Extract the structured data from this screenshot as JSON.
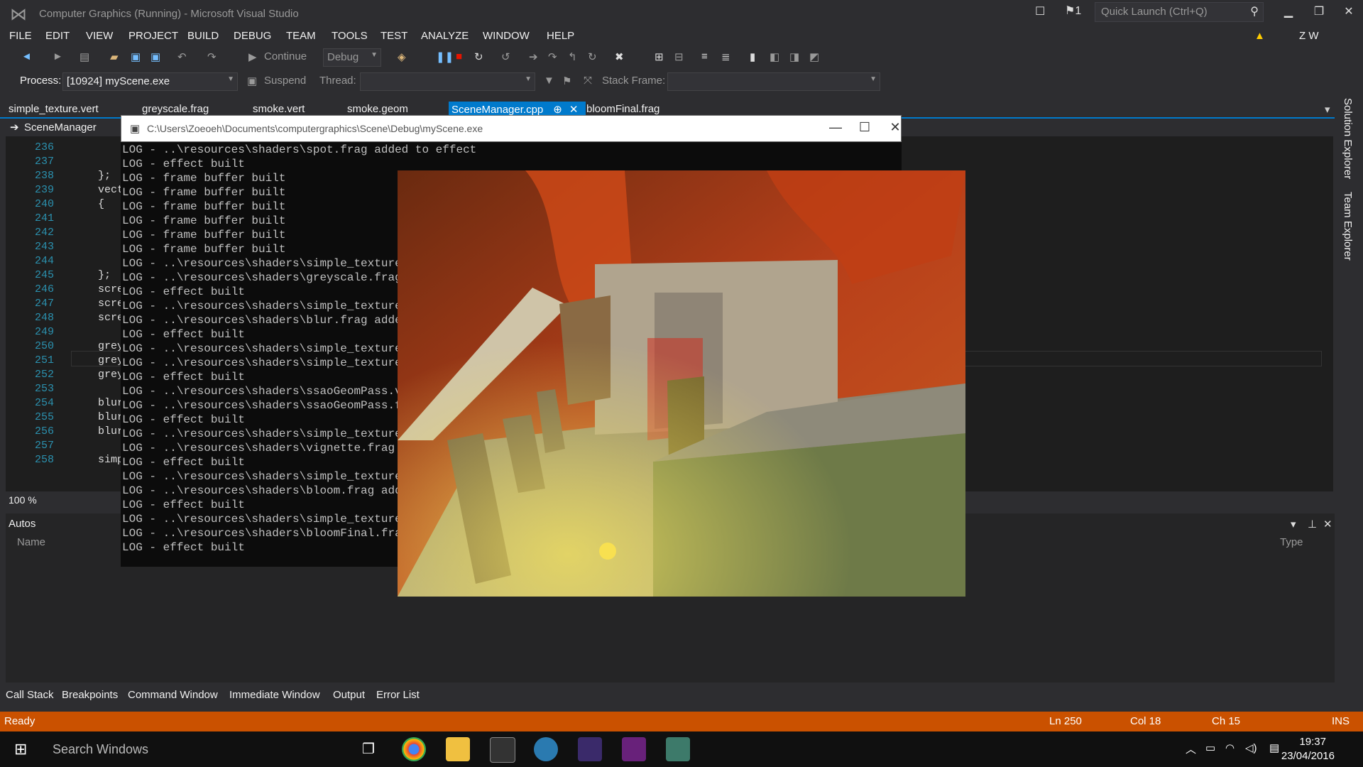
{
  "window": {
    "title": "Computer Graphics (Running) - Microsoft Visual Studio",
    "user": "Z W",
    "notifications": "1",
    "quick_launch_placeholder": "Quick Launch (Ctrl+Q)"
  },
  "menu": [
    "FILE",
    "EDIT",
    "VIEW",
    "PROJECT",
    "BUILD",
    "DEBUG",
    "TEAM",
    "TOOLS",
    "TEST",
    "ANALYZE",
    "WINDOW",
    "HELP"
  ],
  "toolbar": {
    "continue_label": "Continue",
    "config": "Debug",
    "process_label": "Process:",
    "process_value": "[10924] myScene.exe",
    "suspend_label": "Suspend",
    "thread_label": "Thread:",
    "stack_frame_label": "Stack Frame:"
  },
  "tabs": [
    "simple_texture.vert",
    "greyscale.frag",
    "smoke.vert",
    "smoke.geom",
    "SceneManager.cpp",
    "bloomFinal.frag"
  ],
  "active_tab_index": 4,
  "nav": {
    "scope": "SceneManager"
  },
  "editor": {
    "line_numbers": [
      "236",
      "237",
      "238",
      "239",
      "240",
      "241",
      "242",
      "243",
      "244",
      "245",
      "246",
      "247",
      "248",
      "249",
      "250",
      "251",
      "252",
      "253",
      "254",
      "255",
      "256",
      "257",
      "258"
    ],
    "code_lines": [
      "",
      "",
      "};",
      "vect",
      "{",
      "",
      "",
      "",
      "",
      "};",
      "scre",
      "scre",
      "scre",
      "",
      "grey",
      "grey",
      "grey",
      "",
      "blur",
      "blur",
      "blur",
      "",
      "simp"
    ],
    "zoom": "100 %"
  },
  "autos": {
    "title": "Autos",
    "col_name": "Name",
    "col_type": "Type"
  },
  "bottom_tabs": [
    "Call Stack",
    "Breakpoints",
    "Command Window",
    "Immediate Window",
    "Output",
    "Error List"
  ],
  "status": {
    "state": "Ready",
    "ln": "Ln 250",
    "col": "Col 18",
    "ch": "Ch 15",
    "mode": "INS"
  },
  "side_tabs": [
    "Solution Explorer",
    "Team Explorer"
  ],
  "console": {
    "title": "C:\\Users\\Zoeoeh\\Documents\\computergraphics\\Scene\\Debug\\myScene.exe",
    "lines": [
      "LOG - ..\\resources\\shaders\\spot.frag added to effect",
      "LOG - effect built",
      "LOG - frame buffer built",
      "LOG - frame buffer built",
      "LOG - frame buffer built",
      "LOG - frame buffer built",
      "LOG - frame buffer built",
      "LOG - frame buffer built",
      "LOG - ..\\resources\\shaders\\simple_texture.ve",
      "LOG - ..\\resources\\shaders\\greyscale.frag ad",
      "LOG - effect built",
      "LOG - ..\\resources\\shaders\\simple_texture.ve",
      "LOG - ..\\resources\\shaders\\blur.frag added t",
      "LOG - effect built",
      "LOG - ..\\resources\\shaders\\simple_texture.ve",
      "LOG - ..\\resources\\shaders\\simple_texture.fr",
      "LOG - effect built",
      "LOG - ..\\resources\\shaders\\ssaoGeomPass.vert",
      "LOG - ..\\resources\\shaders\\ssaoGeomPass.frag",
      "LOG - effect built",
      "LOG - ..\\resources\\shaders\\simple_texture.ve",
      "LOG - ..\\resources\\shaders\\vignette.frag add",
      "LOG - effect built",
      "LOG - ..\\resources\\shaders\\simple_texture.ve",
      "LOG - ..\\resources\\shaders\\bloom.frag added",
      "LOG - effect built",
      "LOG - ..\\resources\\shaders\\simple_texture.ve",
      "LOG - ..\\resources\\shaders\\bloomFinal.frag a",
      "LOG - effect built"
    ]
  },
  "taskbar": {
    "search_placeholder": "Search Windows",
    "time": "19:37",
    "date": "23/04/2016"
  },
  "colors": {
    "accent": "#007acc",
    "status_debug": "#ca5100",
    "chrome": "#2d2d30"
  }
}
